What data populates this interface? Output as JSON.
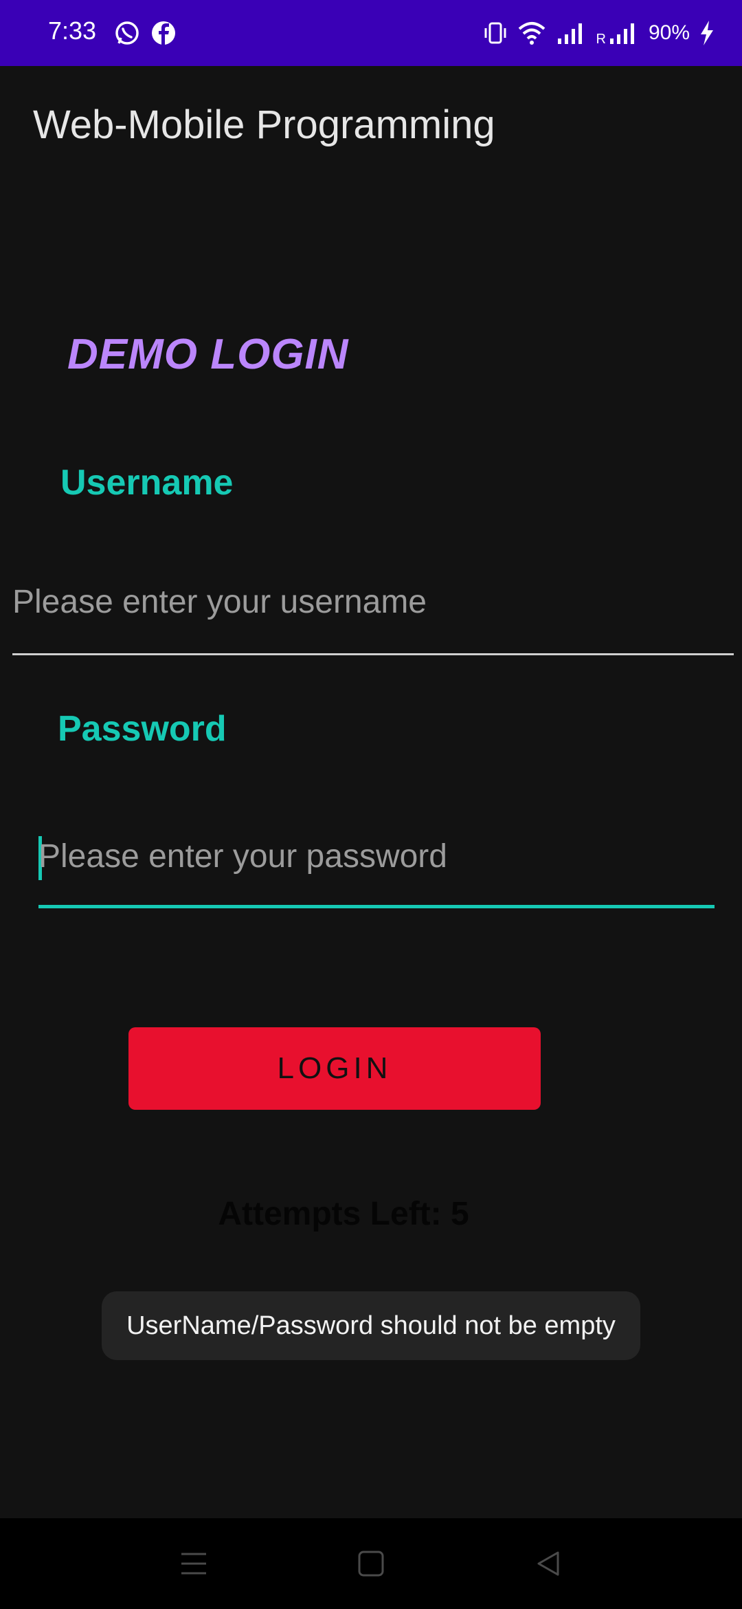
{
  "status_bar": {
    "time": "7:33",
    "battery_text": "90%",
    "background_color": "#3A00B6",
    "icons": [
      "whatsapp-icon",
      "facebook-icon",
      "vibrate-icon",
      "wifi-icon",
      "signal-icon",
      "roaming-signal-icon",
      "charging-icon"
    ],
    "roaming_label": "R"
  },
  "app_bar": {
    "title": "Web-Mobile Programming"
  },
  "login_form": {
    "heading": "DEMO LOGIN",
    "username_label": "Username",
    "username_placeholder": "Please enter your username",
    "username_value": "",
    "password_label": "Password",
    "password_placeholder": "Please enter your password",
    "password_value": "",
    "login_button": "LOGIN",
    "attempts_text": "Attempts Left: 5"
  },
  "toast": {
    "message": "UserName/Password should not be empty"
  },
  "colors": {
    "accent_purple": "#BB86FC",
    "accent_teal": "#16C9B4",
    "button_red": "#E8102E",
    "background": "#121212"
  },
  "nav_bar": {
    "buttons": [
      "menu-icon",
      "home-icon",
      "back-icon"
    ]
  }
}
